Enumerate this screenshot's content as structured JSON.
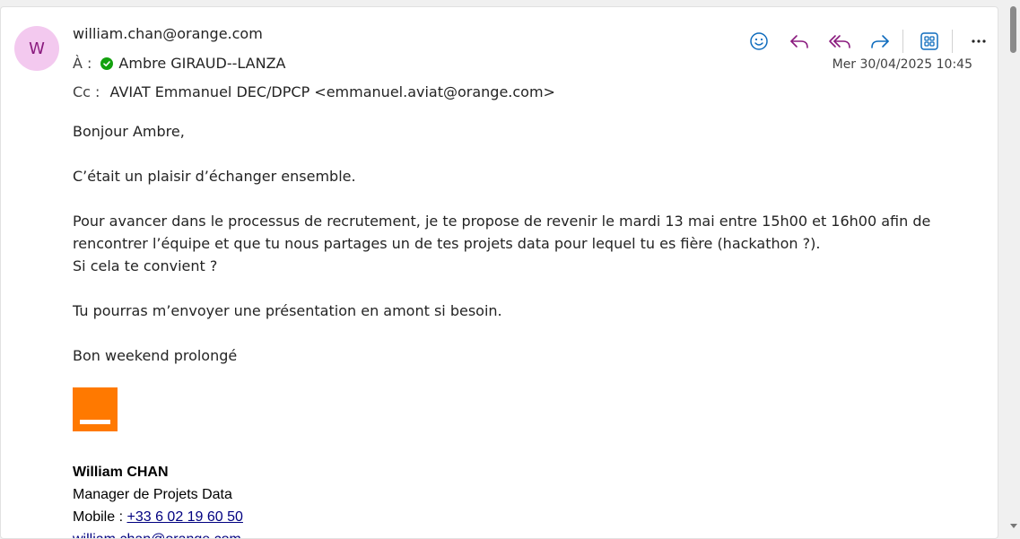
{
  "header": {
    "avatar_initial": "W",
    "sender": "william.chan@orange.com",
    "to_label": "À :",
    "to_name": "Ambre GIRAUD--LANZA",
    "cc_label": "Cc :",
    "cc_value": "AVIAT Emmanuel DEC/DPCP <emmanuel.aviat@orange.com>",
    "date": "Mer 30/04/2025 10:45"
  },
  "toolbar": {
    "icons": [
      "emoji-icon",
      "reply-icon",
      "reply-all-icon",
      "forward-icon",
      "apps-icon",
      "more-icon"
    ]
  },
  "body": {
    "greeting": "Bonjour Ambre,",
    "p1": "C’était un plaisir d’échanger ensemble.",
    "p2_line1": "Pour avancer dans le processus de recrutement, je te propose de revenir le mardi 13 mai entre 15h00 et 16h00 afin de",
    "p2_line2": "rencontrer l’équipe et que tu nous partages un de tes projets data pour lequel tu es fière (hackathon ?).",
    "p2_line3": "Si cela te convient ?",
    "p3": "Tu pourras m’envoyer une présentation en amont si besoin.",
    "p4": "Bon weekend prolongé"
  },
  "signature": {
    "name": "William CHAN",
    "title": "Manager de Projets Data",
    "mobile_label": "Mobile :",
    "mobile": "+33 6 02 19 60 50",
    "email_partial": "william.chan@orange.com"
  },
  "colors": {
    "accent_blue": "#0f6cbd",
    "accent_purple": "#8a1a7e",
    "orange": "#ff7900",
    "presence_green": "#13a10e"
  }
}
